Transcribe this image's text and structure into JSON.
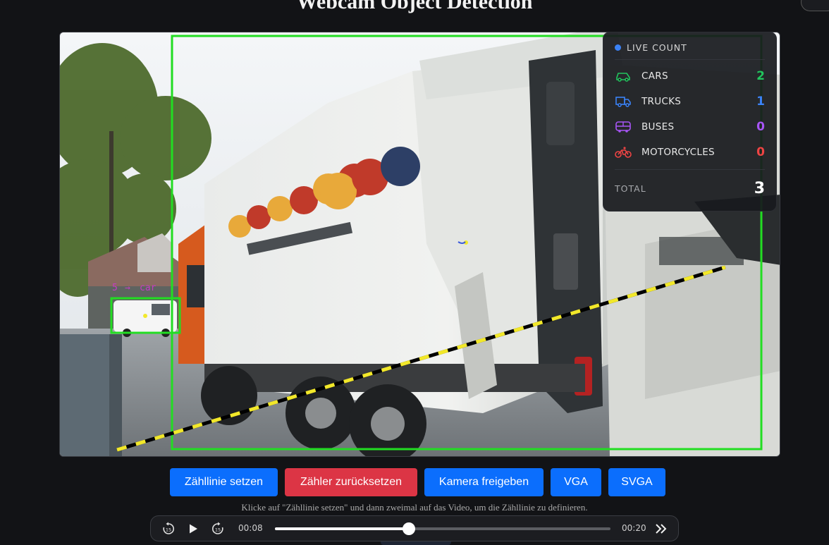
{
  "page": {
    "title": "Webcam Object Detection"
  },
  "video": {
    "label_id": "5",
    "label_arrow": "→",
    "label_class": "car"
  },
  "live_count": {
    "header": "LIVE COUNT",
    "items": [
      {
        "label": "CARS",
        "value": "2",
        "color": "#22c55e",
        "icon": "car-icon"
      },
      {
        "label": "TRUCKS",
        "value": "1",
        "color": "#3b82f6",
        "icon": "truck-icon"
      },
      {
        "label": "BUSES",
        "value": "0",
        "color": "#a855f7",
        "icon": "bus-icon"
      },
      {
        "label": "MOTORCYCLES",
        "value": "0",
        "color": "#ef4444",
        "icon": "motorcycle-icon"
      }
    ],
    "total_label": "TOTAL",
    "total_value": "3"
  },
  "buttons": {
    "set_line": "Zähllinie setzen",
    "reset_counter": "Zähler zurücksetzen",
    "release_camera": "Kamera freigeben",
    "vga": "VGA",
    "svga": "SVGA"
  },
  "hint": "Klicke auf \"Zähllinie setzen\" und dann zweimal auf das Video, um die Zähllinie zu definieren.",
  "player": {
    "current_time": "00:08",
    "duration": "00:20",
    "progress": 0.4,
    "rewind_seconds": "15",
    "forward_seconds": "15"
  },
  "colors": {
    "accent_blue": "#0b6efd",
    "danger_red": "#dc3545",
    "detection_green": "#22dd22",
    "count_line_yellow": "#f2e82a"
  }
}
